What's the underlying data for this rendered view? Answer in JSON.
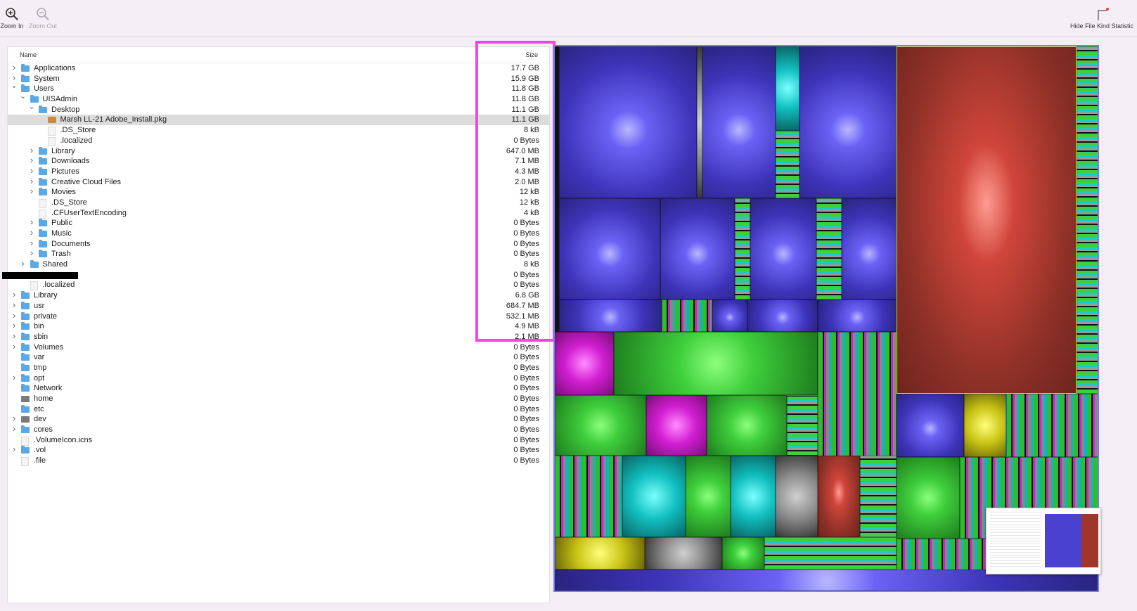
{
  "toolbar": {
    "zoom_in": "Zoom In",
    "zoom_out": "Zoom Out",
    "hide_file_kind": "Hide File Kind Statistic"
  },
  "columns": {
    "name": "Name",
    "size": "Size"
  },
  "rows": [
    {
      "name": "Applications",
      "size": "17.7 GB",
      "depth": 0,
      "disc": "right",
      "icon": "folder"
    },
    {
      "name": "System",
      "size": "15.9 GB",
      "depth": 0,
      "disc": "right",
      "icon": "folder"
    },
    {
      "name": "Users",
      "size": "11.8 GB",
      "depth": 0,
      "disc": "down",
      "icon": "folder"
    },
    {
      "name": "UISAdmin",
      "size": "11.8 GB",
      "depth": 1,
      "disc": "down",
      "icon": "folder"
    },
    {
      "name": "Desktop",
      "size": "11.1 GB",
      "depth": 2,
      "disc": "down",
      "icon": "folder"
    },
    {
      "name": "Marsh LL-21 Adobe_Install.pkg",
      "size": "11.1 GB",
      "depth": 3,
      "disc": "",
      "icon": "pkg",
      "selected": true
    },
    {
      "name": ".DS_Store",
      "size": "8 kB",
      "depth": 3,
      "disc": "",
      "icon": "file"
    },
    {
      "name": ".localized",
      "size": "0 Bytes",
      "depth": 3,
      "disc": "",
      "icon": "file"
    },
    {
      "name": "Library",
      "size": "647.0 MB",
      "depth": 2,
      "disc": "right",
      "icon": "folder"
    },
    {
      "name": "Downloads",
      "size": "7.1 MB",
      "depth": 2,
      "disc": "right",
      "icon": "folder"
    },
    {
      "name": "Pictures",
      "size": "4.3 MB",
      "depth": 2,
      "disc": "right",
      "icon": "folder"
    },
    {
      "name": "Creative Cloud Files",
      "size": "2.0 MB",
      "depth": 2,
      "disc": "right",
      "icon": "folder"
    },
    {
      "name": "Movies",
      "size": "12 kB",
      "depth": 2,
      "disc": "right",
      "icon": "folder"
    },
    {
      "name": ".DS_Store",
      "size": "12 kB",
      "depth": 2,
      "disc": "",
      "icon": "file"
    },
    {
      "name": ".CFUserTextEncoding",
      "size": "4 kB",
      "depth": 2,
      "disc": "",
      "icon": "file"
    },
    {
      "name": "Public",
      "size": "0 Bytes",
      "depth": 2,
      "disc": "right",
      "icon": "folder"
    },
    {
      "name": "Music",
      "size": "0 Bytes",
      "depth": 2,
      "disc": "right",
      "icon": "folder"
    },
    {
      "name": "Documents",
      "size": "0 Bytes",
      "depth": 2,
      "disc": "right",
      "icon": "folder"
    },
    {
      "name": "Trash",
      "size": "0 Bytes",
      "depth": 2,
      "disc": "right",
      "icon": "folder"
    },
    {
      "name": "Shared",
      "size": "8 kB",
      "depth": 1,
      "disc": "right",
      "icon": "folder"
    },
    {
      "name": "",
      "size": "0 Bytes",
      "depth": 1,
      "disc": "",
      "icon": "none",
      "redacted": true
    },
    {
      "name": ".localized",
      "size": "0 Bytes",
      "depth": 1,
      "disc": "",
      "icon": "file"
    },
    {
      "name": "Library",
      "size": "6.8 GB",
      "depth": 0,
      "disc": "right",
      "icon": "folder"
    },
    {
      "name": "usr",
      "size": "684.7 MB",
      "depth": 0,
      "disc": "right",
      "icon": "folder"
    },
    {
      "name": "private",
      "size": "532.1 MB",
      "depth": 0,
      "disc": "right",
      "icon": "folder"
    },
    {
      "name": "bin",
      "size": "4.9 MB",
      "depth": 0,
      "disc": "right",
      "icon": "folder"
    },
    {
      "name": "sbin",
      "size": "2.1 MB",
      "depth": 0,
      "disc": "right",
      "icon": "folder"
    },
    {
      "name": "Volumes",
      "size": "0 Bytes",
      "depth": 0,
      "disc": "right",
      "icon": "folder"
    },
    {
      "name": "var",
      "size": "0 Bytes",
      "depth": 0,
      "disc": "",
      "icon": "folder"
    },
    {
      "name": "tmp",
      "size": "0 Bytes",
      "depth": 0,
      "disc": "",
      "icon": "folder"
    },
    {
      "name": "opt",
      "size": "0 Bytes",
      "depth": 0,
      "disc": "right",
      "icon": "folder"
    },
    {
      "name": "Network",
      "size": "0 Bytes",
      "depth": 0,
      "disc": "",
      "icon": "folder"
    },
    {
      "name": "home",
      "size": "0 Bytes",
      "depth": 0,
      "disc": "",
      "icon": "drive"
    },
    {
      "name": "etc",
      "size": "0 Bytes",
      "depth": 0,
      "disc": "",
      "icon": "folder"
    },
    {
      "name": "dev",
      "size": "0 Bytes",
      "depth": 0,
      "disc": "right",
      "icon": "drive"
    },
    {
      "name": "cores",
      "size": "0 Bytes",
      "depth": 0,
      "disc": "right",
      "icon": "folder"
    },
    {
      "name": ".VolumeIcon.icns",
      "size": "0 Bytes",
      "depth": 0,
      "disc": "",
      "icon": "file"
    },
    {
      "name": ".vol",
      "size": "0 Bytes",
      "depth": 0,
      "disc": "right",
      "icon": "folder"
    },
    {
      "name": ".file",
      "size": "0 Bytes",
      "depth": 0,
      "disc": "",
      "icon": "file"
    }
  ],
  "colors": {
    "highlight": "#ff3ff0",
    "selected_row": "#dcdcdc",
    "folder": "#5aa9e6",
    "treemap_selected": "#a0352c"
  }
}
